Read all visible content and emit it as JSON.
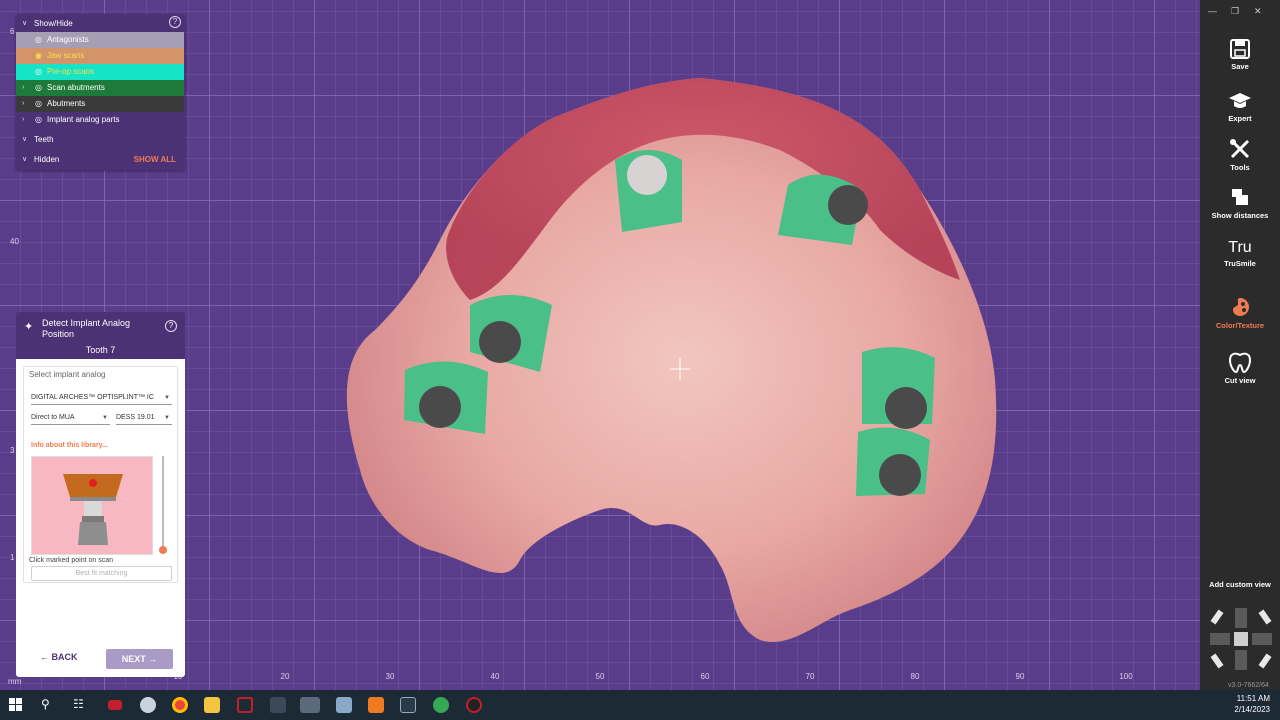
{
  "show_hide": {
    "title": "Show/Hide",
    "help": "?",
    "rows": [
      {
        "label": "Antagonists"
      },
      {
        "label": "Jaw scans"
      },
      {
        "label": "Pre-op scans"
      },
      {
        "label": "Scan abutments"
      },
      {
        "label": "Abutments"
      },
      {
        "label": "Implant analog parts"
      },
      {
        "label": "Teeth"
      },
      {
        "label": "Hidden"
      }
    ],
    "show_all": "SHOW ALL"
  },
  "detect_panel": {
    "title": "Detect Implant Analog Position",
    "help": "?",
    "tooth": "Tooth 7",
    "select_label": "Select implant analog",
    "library_value": "DIGITAL ARCHES™ OPTISPLINT™ IC",
    "connection_value": "Direct to MUA",
    "version_value": "DESS 19.01",
    "info_link": "Info about this library...",
    "click_text": "Click marked point on scan",
    "best_fit": "Best fit matching",
    "back": "BACK",
    "next": "NEXT"
  },
  "axis": {
    "x_ticks": [
      "10",
      "20",
      "30",
      "40",
      "50",
      "60",
      "70",
      "80",
      "90",
      "100"
    ],
    "y_ticks": [
      "6",
      "40",
      "3",
      "1"
    ],
    "unit": "mm"
  },
  "toolbar": {
    "tools": [
      {
        "label": "Save",
        "icon": "save-icon"
      },
      {
        "label": "Expert",
        "icon": "graduation-cap-icon"
      },
      {
        "label": "Tools",
        "icon": "tools-icon"
      },
      {
        "label": "Show distances",
        "icon": "distance-icon"
      },
      {
        "label": "TruSmile",
        "icon": "trusmile-icon",
        "glyph": "Tru"
      },
      {
        "label": "Color/Texture",
        "icon": "color-texture-icon"
      },
      {
        "label": "Cut view",
        "icon": "tooth-icon"
      }
    ],
    "add_custom_view": "Add custom view",
    "version": "v3.0-7662/64"
  },
  "taskbar": {
    "time": "11:51 AM",
    "date": "2/14/2023"
  },
  "colors": {
    "panel": "#4b3275",
    "accent": "#f07a52",
    "jaw_row": "#d4946a",
    "preop_row": "#17e3c6",
    "scan_abut_row": "#1e7a3a",
    "antagonist_row": "#a59fb3"
  }
}
